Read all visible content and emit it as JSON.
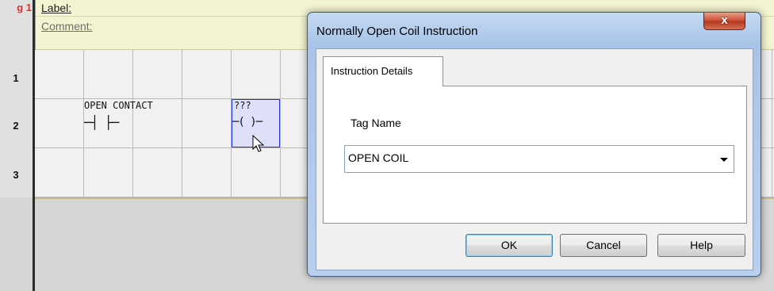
{
  "editor": {
    "rung_tag": "g 1",
    "label": "Label:",
    "comment": "Comment:",
    "rung_numbers": [
      "1",
      "2",
      "3"
    ],
    "contact": {
      "label": "OPEN CONTACT",
      "symbol": "─┤ ├─",
      "icon": "normally-open-contact-icon"
    },
    "coil": {
      "label": "???",
      "symbol": "─( )─",
      "icon": "normally-open-coil-icon",
      "selected": true
    }
  },
  "dialog": {
    "title": "Normally Open Coil Instruction",
    "close_label": "x",
    "tabs": [
      {
        "label": "Instruction Details",
        "active": true
      }
    ],
    "tag_name_label": "Tag Name",
    "tag_name_value": "OPEN COIL",
    "buttons": {
      "ok": "OK",
      "cancel": "Cancel",
      "help": "Help"
    }
  },
  "colors": {
    "rung_tag": "#e0302a",
    "selection_border": "#2433e0",
    "header_strip": "#f4f4d2",
    "title_bar": "#b9cfee",
    "close_button": "#cb4a2f"
  }
}
